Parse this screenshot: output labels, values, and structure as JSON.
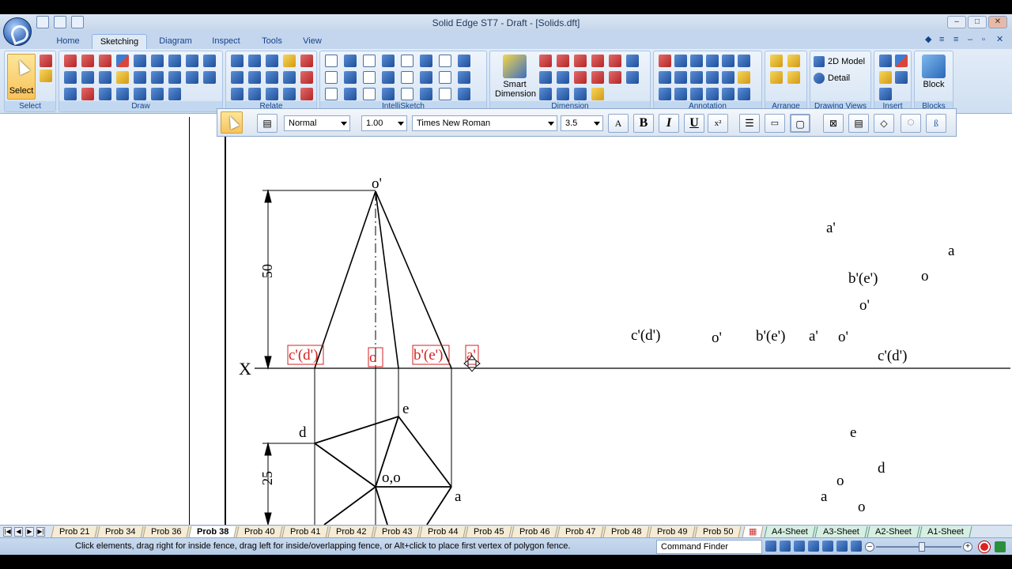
{
  "window": {
    "title": "Solid Edge ST7 - Draft - [Solids.dft]"
  },
  "ribbon_tabs": [
    "Home",
    "Sketching",
    "Diagram",
    "Inspect",
    "Tools",
    "View"
  ],
  "active_tab": "Sketching",
  "ribbon": {
    "select_label": "Select",
    "groups": {
      "select": "Select",
      "draw": "Draw",
      "relate": "Relate",
      "intellisketch": "IntelliSketch",
      "dimension": "Dimension",
      "annotation": "Annotation",
      "arrange": "Arrange",
      "drawing_views": "Drawing Views",
      "insert": "Insert",
      "blocks": "Blocks"
    },
    "smart_dimension_line1": "Smart",
    "smart_dimension_line2": "Dimension",
    "model_2d": "2D Model",
    "detail": "Detail",
    "block": "Block"
  },
  "format_bar": {
    "style": "Normal",
    "line_spacing": "1.00",
    "font": "Times New Roman",
    "font_size": "3.5",
    "bold": "B",
    "italic": "I",
    "underline": "U"
  },
  "drawing": {
    "dim_height": "50",
    "dim_width": "25",
    "x_label": "X",
    "front_labels": {
      "apex": "o'",
      "cd": "c'(d')",
      "o1": "o",
      "be": "b'(e')",
      "a": "a'"
    },
    "top_labels": {
      "d": "d",
      "e": "e",
      "a": "a",
      "center": "o,o"
    },
    "scatter_labels": {
      "a_prime": "a'",
      "a": "a",
      "be_1": "b'(e')",
      "o1": "o",
      "o1_prime": "o'",
      "cd_1": "c'(d')",
      "o1_prime_2": "o'",
      "be_2": "b'(e')",
      "a_prime_2": "a'",
      "o_prime": "o'",
      "cd_2": "c'(d')",
      "e": "e",
      "d": "d",
      "o": "o",
      "a_2": "a",
      "o1_2": "o"
    }
  },
  "sheet_tabs": [
    "Prob 21",
    "Prob 34",
    "Prob 36",
    "Prob 38",
    "Prob 40",
    "Prob 41",
    "Prob 42",
    "Prob 43",
    "Prob 44",
    "Prob 45",
    "Prob 46",
    "Prob 47",
    "Prob 48",
    "Prob 49",
    "Prob 50"
  ],
  "active_sheet": "Prob 38",
  "bg_sheets": [
    "A4-Sheet",
    "A3-Sheet",
    "A2-Sheet",
    "A1-Sheet"
  ],
  "status": {
    "message": "Click elements, drag right for inside fence, drag left for inside/overlapping fence, or Alt+click to place first vertex of polygon fence.",
    "command_finder": "Command Finder"
  },
  "colors": {
    "highlight_red": "#d42020",
    "ribbon_blue": "#c4d6ee"
  }
}
